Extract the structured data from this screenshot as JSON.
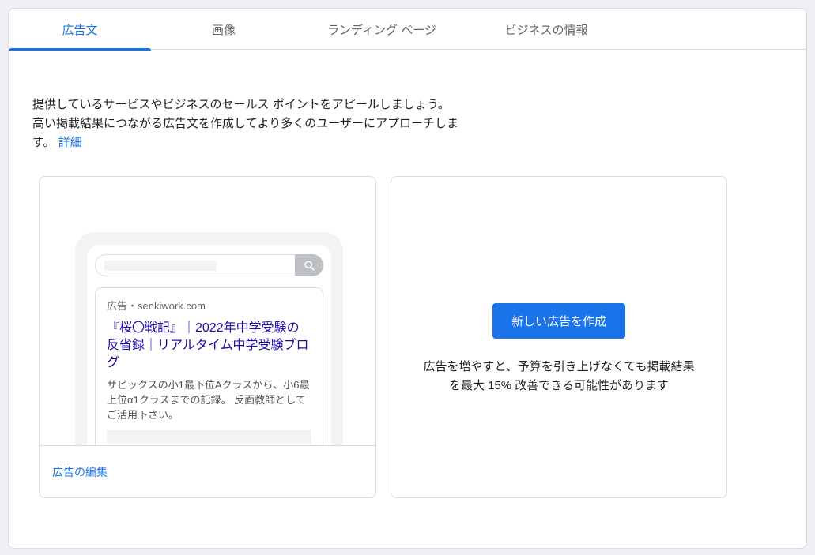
{
  "colors": {
    "accent_blue": "#1a73e8",
    "ad_headline_blue": "#1a0dab",
    "border_gray": "#dadce0",
    "text_dark": "#202124",
    "text_gray": "#5f6368",
    "skeleton_gray": "#f1f3f4"
  },
  "tabs": [
    {
      "label": "広告文",
      "active": true
    },
    {
      "label": "画像",
      "active": false
    },
    {
      "label": "ランディング ページ",
      "active": false
    },
    {
      "label": "ビジネスの情報",
      "active": false
    }
  ],
  "intro": {
    "line1": "提供しているサービスやビジネスのセールス ポイントをアピールしましょう。",
    "line2": "高い掲載結果につながる広告文を作成してより多くのユーザーにアプローチしま",
    "line3": "す。",
    "details_link": "詳細"
  },
  "ad_preview": {
    "display_url_line": "広告・senkiwork.com",
    "headline": "『桜〇戦記』｜2022年中学受験の反省録｜リアルタイム中学受験ブログ",
    "description": "サピックスの小1最下位Aクラスから、小6最上位α1クラスまでの記録。 反面教師としてご活用下さい。",
    "edit_link_label": "広告の編集",
    "search_icon": "magnifier"
  },
  "create_panel": {
    "button_label": "新しい広告を作成",
    "hint_line1": "広告を増やすと、予算を引き上げなくても掲載結果",
    "hint_line2": "を最大 15% 改善できる可能性があります"
  }
}
